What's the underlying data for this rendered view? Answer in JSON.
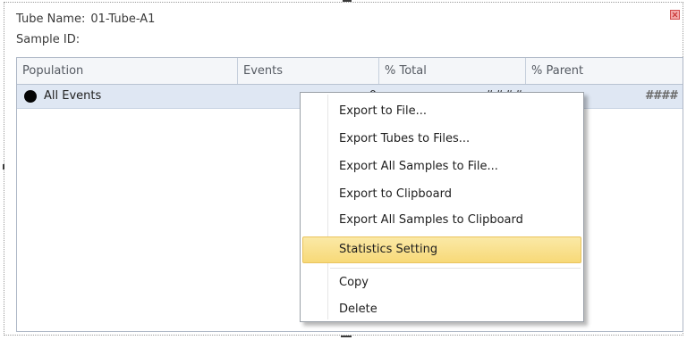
{
  "panel": {
    "tube_name_label": "Tube Name:",
    "tube_name_value": "01-Tube-A1",
    "sample_id_label": "Sample ID:",
    "sample_id_value": ""
  },
  "table": {
    "columns": [
      "Population",
      "Events",
      "% Total",
      "% Parent"
    ],
    "rows": [
      {
        "population": "All Events",
        "events": "0",
        "total": "####",
        "parent": "####"
      }
    ]
  },
  "context_menu": {
    "items": [
      "Export to File...",
      "Export Tubes to Files...",
      "Export All Samples to File...",
      "Export to Clipboard",
      "Export All Samples to Clipboard",
      "Statistics Setting",
      "Copy",
      "Delete"
    ],
    "highlighted_item": "Statistics Setting"
  },
  "colors": {
    "close_icon": "#d24c4c",
    "row_selected": "#dfe7f3",
    "menu_highlight": "#f7d978"
  },
  "icons": {
    "close": "close-icon",
    "population_marker": "black-dot-icon"
  }
}
